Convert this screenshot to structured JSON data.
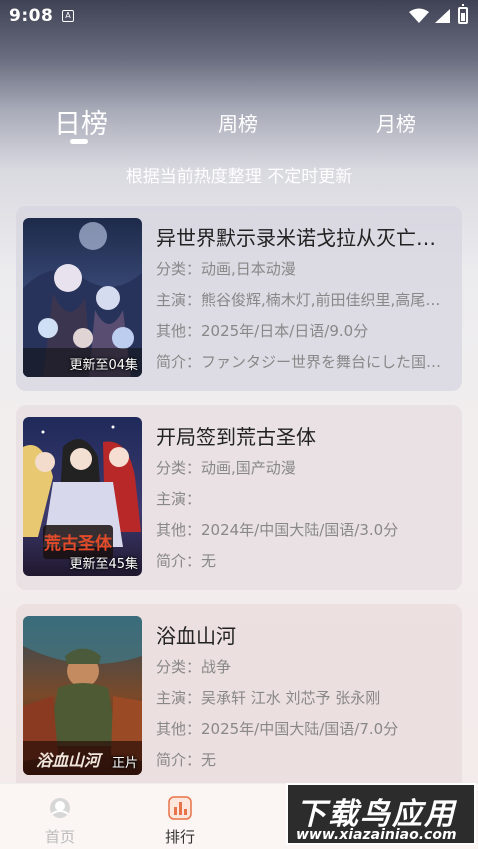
{
  "status": {
    "time": "9:08"
  },
  "tabs": [
    {
      "label": "日榜",
      "active": true
    },
    {
      "label": "周榜",
      "active": false
    },
    {
      "label": "月榜",
      "active": false
    }
  ],
  "subtitle": "根据当前热度整理 不定时更新",
  "cards": [
    {
      "title": "异世界默示录米诺戈拉从灭亡开始",
      "category": "分类：动画,日本动漫",
      "cast": "主演：熊谷俊辉,楠木灯,前田佳织里,高尾奏音",
      "other": "其他：2025年/日本/日语/9.0分",
      "intro": "简介：ファンタジー世界を舞台にした国家経営",
      "badge": "更新至04集"
    },
    {
      "title": "开局签到荒古圣体",
      "category": "分类：动画,国产动漫",
      "cast": "主演：",
      "other": "其他：2024年/中国大陆/国语/3.0分",
      "intro": "简介：无",
      "badge": "更新至45集",
      "poster_text": "荒古圣体"
    },
    {
      "title": "浴血山河",
      "category": "分类：战争",
      "cast": "主演：吴承轩 江水 刘芯予 张永刚",
      "other": "其他：2025年/中国大陆/国语/7.0分",
      "intro": "简介：无",
      "badge": "正片",
      "poster_text": "浴血山河"
    }
  ],
  "nav": {
    "home_label": "首页",
    "rank_label": "排行"
  },
  "watermark": {
    "line1": "下载鸟应用",
    "line2": "www.xiazainiao.com"
  }
}
